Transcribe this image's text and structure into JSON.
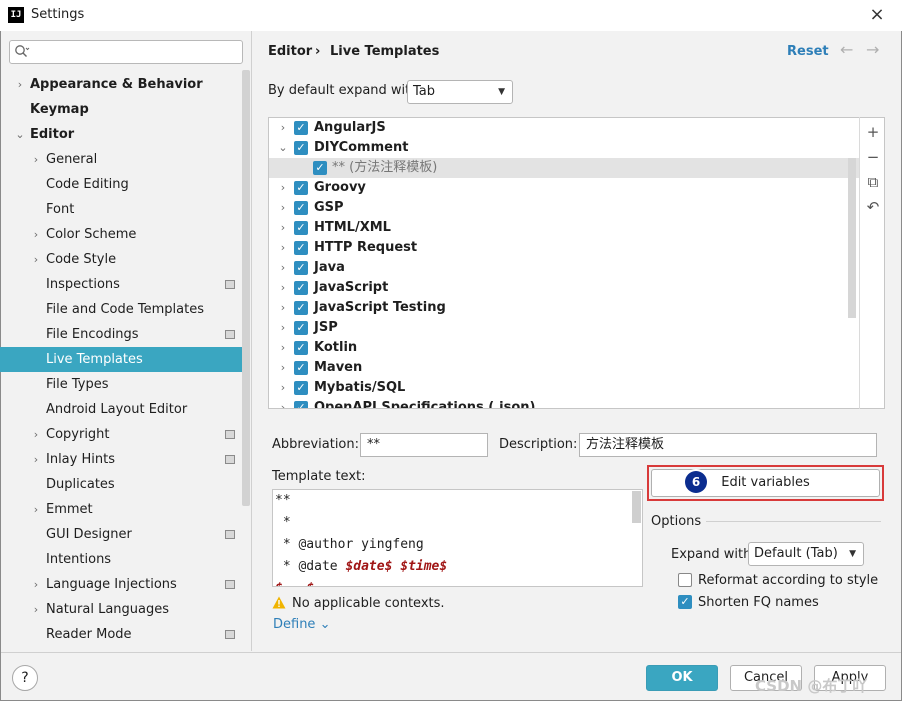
{
  "window": {
    "title": "Settings",
    "logo": "IJ",
    "close_glyph": "×"
  },
  "search": {
    "placeholder": "",
    "icon": "search-icon"
  },
  "sidebar": {
    "items": [
      {
        "label": "Appearance & Behavior",
        "arrow": "›"
      },
      {
        "label": "Keymap",
        "arrow": ""
      },
      {
        "label": "Editor",
        "arrow": "⌄"
      },
      {
        "label": "General",
        "arrow": "›"
      },
      {
        "label": "Code Editing",
        "arrow": ""
      },
      {
        "label": "Font",
        "arrow": ""
      },
      {
        "label": "Color Scheme",
        "arrow": "›"
      },
      {
        "label": "Code Style",
        "arrow": "›"
      },
      {
        "label": "Inspections",
        "arrow": ""
      },
      {
        "label": "File and Code Templates",
        "arrow": ""
      },
      {
        "label": "File Encodings",
        "arrow": ""
      },
      {
        "label": "Live Templates",
        "arrow": ""
      },
      {
        "label": "File Types",
        "arrow": ""
      },
      {
        "label": "Android Layout Editor",
        "arrow": ""
      },
      {
        "label": "Copyright",
        "arrow": "›"
      },
      {
        "label": "Inlay Hints",
        "arrow": "›"
      },
      {
        "label": "Duplicates",
        "arrow": ""
      },
      {
        "label": "Emmet",
        "arrow": "›"
      },
      {
        "label": "GUI Designer",
        "arrow": ""
      },
      {
        "label": "Intentions",
        "arrow": ""
      },
      {
        "label": "Language Injections",
        "arrow": "›"
      },
      {
        "label": "Natural Languages",
        "arrow": "›"
      },
      {
        "label": "Reader Mode",
        "arrow": ""
      }
    ]
  },
  "header": {
    "crumb_parent": "Editor",
    "crumb_sep": "›",
    "crumb_current": "Live Templates",
    "reset": "Reset",
    "back": "←",
    "forward": "→"
  },
  "expand": {
    "label": "By default expand with",
    "value": "Tab",
    "caret": "▼"
  },
  "template_list": {
    "rows": [
      {
        "arrow": "›",
        "label": "AngularJS",
        "checked": "✓"
      },
      {
        "arrow": "⌄",
        "label": "DIYComment",
        "checked": "✓"
      },
      {
        "arrow": "",
        "label": "** (方法注释模板)",
        "checked": "✓"
      },
      {
        "arrow": "›",
        "label": "Groovy",
        "checked": "✓"
      },
      {
        "arrow": "›",
        "label": "GSP",
        "checked": "✓"
      },
      {
        "arrow": "›",
        "label": "HTML/XML",
        "checked": "✓"
      },
      {
        "arrow": "›",
        "label": "HTTP Request",
        "checked": "✓"
      },
      {
        "arrow": "›",
        "label": "Java",
        "checked": "✓"
      },
      {
        "arrow": "›",
        "label": "JavaScript",
        "checked": "✓"
      },
      {
        "arrow": "›",
        "label": "JavaScript Testing",
        "checked": "✓"
      },
      {
        "arrow": "›",
        "label": "JSP",
        "checked": "✓"
      },
      {
        "arrow": "›",
        "label": "Kotlin",
        "checked": "✓"
      },
      {
        "arrow": "›",
        "label": "Maven",
        "checked": "✓"
      },
      {
        "arrow": "›",
        "label": "Mybatis/SQL",
        "checked": "✓"
      },
      {
        "arrow": "›",
        "label": "OpenAPI Specifications (.json)",
        "checked": "✓"
      }
    ],
    "tools": {
      "add": "+",
      "remove": "−",
      "copy": "⧉",
      "restore": "↶"
    }
  },
  "fields": {
    "abbreviation_label": "Abbreviation:",
    "abbreviation_value": "**",
    "description_label": "Description:",
    "description_value": "方法注释模板"
  },
  "template_text": {
    "label": "Template text:",
    "lines": [
      "**",
      " *",
      " * @author yingfeng",
      " * @date ",
      "$date$",
      "$time$",
      "$",
      "$"
    ]
  },
  "edit_variables": {
    "label": "Edit variables",
    "step": "6"
  },
  "options": {
    "label": "Options",
    "expand_label": "Expand with",
    "expand_value": "Default (Tab)",
    "reformat_label": "Reformat according to style",
    "shorten_label": "Shorten FQ names",
    "shorten_check": "✓"
  },
  "context": {
    "warning": "No applicable contexts.",
    "define": "Define",
    "define_caret": "⌄"
  },
  "footer": {
    "help": "?",
    "ok": "OK",
    "cancel": "Cancel",
    "apply": "Apply"
  },
  "watermark": "CSDN @布丁吖"
}
